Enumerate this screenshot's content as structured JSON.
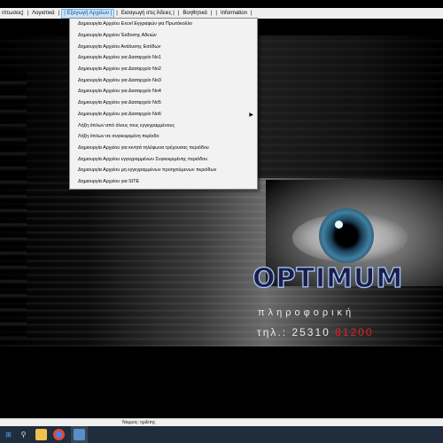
{
  "menubar": {
    "items": [
      {
        "label": "ιπτωσεις|"
      },
      {
        "label": "Λογιστικά"
      },
      {
        "label": "| Εξαγωγή Αρχείων |"
      },
      {
        "label": "Εισαγωγή στις Άδειες |"
      },
      {
        "label": "Βοηθητικά"
      },
      {
        "label": "Information"
      }
    ]
  },
  "dropdown": {
    "items": [
      {
        "label": "Δημιουργία Αρχείου Excel Εγγραφών για Πρωτόκολλο"
      },
      {
        "label": "Δημιουργία Αρχείου Έκδοσης Αδειών"
      },
      {
        "label": "Δημιουργία Αρχείου Ανάλυσης Εσόδων"
      },
      {
        "label": "Δημιουργία Αρχείου για Δασαρχείο Νο1"
      },
      {
        "label": "Δημιουργία Αρχείου για Δασαρχείο Νο2"
      },
      {
        "label": "Δημιουργία Αρχείου για Δασαρχείο Νο3"
      },
      {
        "label": "Δημιουργία Αρχείου για Δασαρχείο Νο4"
      },
      {
        "label": "Δημιουργία Αρχείου για Δασαρχείο Νο5"
      },
      {
        "label": "Δημιουργία Αρχείου για Δασαρχείο Νο6",
        "has_submenu": true
      },
      {
        "label": "Λήξη όπλων από όλους τους εγγεγραμμένους"
      },
      {
        "label": "Λήξη όπλων σε συγκεκριμένη περίοδο"
      },
      {
        "label": "Δημιουργία Αρχείου για κινητά τηλέφωνα τρέχουσας περιόδου"
      },
      {
        "label": "Δημιουργία Αρχείου εγγεγραμμένων Συγκεκριμένης περιόδου"
      },
      {
        "label": "Δημιουργία Αρχείου μη εγγεγραμμένων προηγούμενων περιόδων"
      },
      {
        "label": "Δημιουργία Αρχείου για SITE"
      }
    ]
  },
  "logo": {
    "word": "OPTIMUM",
    "tagline": "πληροφορική",
    "phone_prefix": "τηλ.: 25310",
    "phone_suffix": "81200"
  },
  "statusbar": {
    "text": "Ναμμος: ηρ&ιτης"
  },
  "colors": {
    "accent_red": "#e02020",
    "active_menu": "#0051a2"
  },
  "taskbar": {
    "icons": [
      "start-icon",
      "search-icon",
      "file-explorer-icon",
      "chrome-icon",
      "mail-icon",
      "app-icon"
    ]
  }
}
